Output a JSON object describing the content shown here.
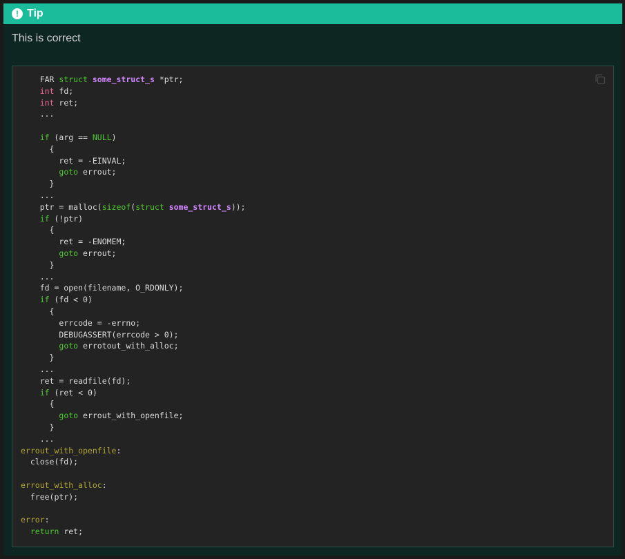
{
  "admonition": {
    "icon": "exclamation-icon",
    "title": "Tip",
    "text": "This is correct"
  },
  "copy_button": {
    "icon": "copy-icon"
  },
  "code": [
    [
      {
        "t": "    FAR "
      },
      {
        "t": "struct",
        "c": "kw"
      },
      {
        "t": " "
      },
      {
        "t": "some_struct_s",
        "c": "nm"
      },
      {
        "t": " *ptr;"
      }
    ],
    [
      {
        "t": "    "
      },
      {
        "t": "int",
        "c": "ty"
      },
      {
        "t": " fd;"
      }
    ],
    [
      {
        "t": "    "
      },
      {
        "t": "int",
        "c": "ty"
      },
      {
        "t": " ret;"
      }
    ],
    [
      {
        "t": "    ..."
      }
    ],
    [
      {
        "t": ""
      }
    ],
    [
      {
        "t": "    "
      },
      {
        "t": "if",
        "c": "kw"
      },
      {
        "t": " (arg == "
      },
      {
        "t": "NULL",
        "c": "kw"
      },
      {
        "t": ")"
      }
    ],
    [
      {
        "t": "      {"
      }
    ],
    [
      {
        "t": "        ret = -EINVAL;"
      }
    ],
    [
      {
        "t": "        "
      },
      {
        "t": "goto",
        "c": "kw"
      },
      {
        "t": " errout;"
      }
    ],
    [
      {
        "t": "      }"
      }
    ],
    [
      {
        "t": "    ..."
      }
    ],
    [
      {
        "t": "    ptr = malloc("
      },
      {
        "t": "sizeof",
        "c": "kw"
      },
      {
        "t": "("
      },
      {
        "t": "struct",
        "c": "kw"
      },
      {
        "t": " "
      },
      {
        "t": "some_struct_s",
        "c": "nm"
      },
      {
        "t": "));"
      }
    ],
    [
      {
        "t": "    "
      },
      {
        "t": "if",
        "c": "kw"
      },
      {
        "t": " (!ptr)"
      }
    ],
    [
      {
        "t": "      {"
      }
    ],
    [
      {
        "t": "        ret = -ENOMEM;"
      }
    ],
    [
      {
        "t": "        "
      },
      {
        "t": "goto",
        "c": "kw"
      },
      {
        "t": " errout;"
      }
    ],
    [
      {
        "t": "      }"
      }
    ],
    [
      {
        "t": "    ..."
      }
    ],
    [
      {
        "t": "    fd = open(filename, O_RDONLY);"
      }
    ],
    [
      {
        "t": "    "
      },
      {
        "t": "if",
        "c": "kw"
      },
      {
        "t": " (fd < 0)"
      }
    ],
    [
      {
        "t": "      {"
      }
    ],
    [
      {
        "t": "        errcode = -errno;"
      }
    ],
    [
      {
        "t": "        DEBUGASSERT(errcode > 0);"
      }
    ],
    [
      {
        "t": "        "
      },
      {
        "t": "goto",
        "c": "kw"
      },
      {
        "t": " errotout_with_alloc;"
      }
    ],
    [
      {
        "t": "      }"
      }
    ],
    [
      {
        "t": "    ..."
      }
    ],
    [
      {
        "t": "    ret = readfile(fd);"
      }
    ],
    [
      {
        "t": "    "
      },
      {
        "t": "if",
        "c": "kw"
      },
      {
        "t": " (ret < 0)"
      }
    ],
    [
      {
        "t": "      {"
      }
    ],
    [
      {
        "t": "        "
      },
      {
        "t": "goto",
        "c": "kw"
      },
      {
        "t": " errout_with_openfile;"
      }
    ],
    [
      {
        "t": "      }"
      }
    ],
    [
      {
        "t": "    ..."
      }
    ],
    [
      {
        "t": "errout_with_openfile",
        "c": "lb"
      },
      {
        "t": ":"
      }
    ],
    [
      {
        "t": "  close(fd);"
      }
    ],
    [
      {
        "t": ""
      }
    ],
    [
      {
        "t": "errout_with_alloc",
        "c": "lb"
      },
      {
        "t": ":"
      }
    ],
    [
      {
        "t": "  free(ptr);"
      }
    ],
    [
      {
        "t": ""
      }
    ],
    [
      {
        "t": "error",
        "c": "lb"
      },
      {
        "t": ":"
      }
    ],
    [
      {
        "t": "  "
      },
      {
        "t": "return",
        "c": "kw"
      },
      {
        "t": " ret;"
      }
    ]
  ]
}
